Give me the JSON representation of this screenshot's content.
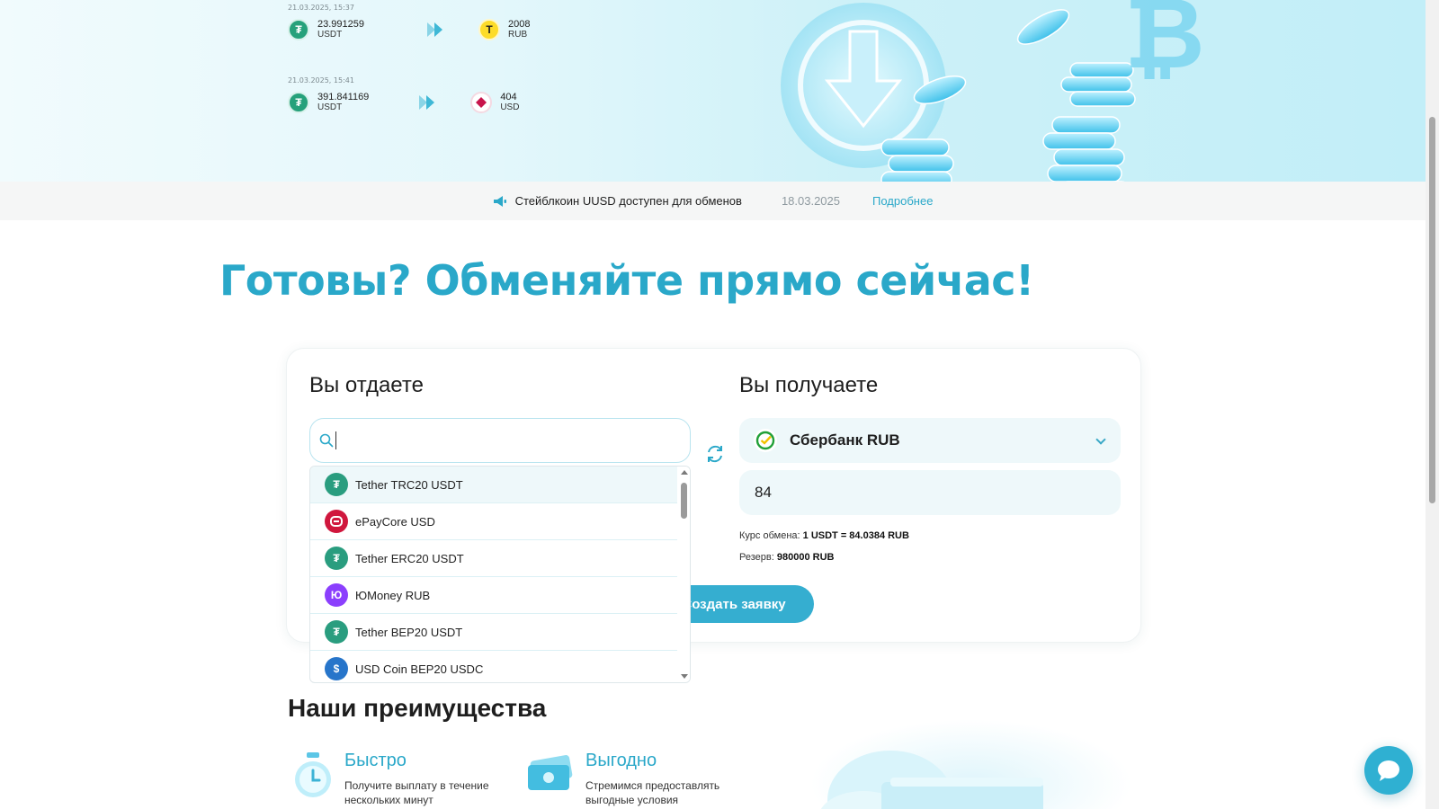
{
  "hero": {
    "transactions": [
      {
        "date": "21.03.2025, 15:37",
        "from_amount": "23.991259",
        "from_currency": "USDT",
        "to_amount": "2008",
        "to_currency": "RUB"
      },
      {
        "date": "21.03.2025, 15:41",
        "from_amount": "391.841169",
        "from_currency": "USDT",
        "to_amount": "404",
        "to_currency": "USD"
      }
    ]
  },
  "news": {
    "text": "Стейблкоин UUSD доступен для обменов",
    "date": "18.03.2025",
    "link": "Подробнее"
  },
  "headline": "Готовы? Обменяйте прямо сейчас!",
  "exchange": {
    "give_title": "Вы отдаете",
    "get_title": "Вы получаете",
    "search_value": "",
    "currency_list": [
      {
        "label": "Tether TRC20 USDT",
        "icon": "tether-icon"
      },
      {
        "label": "ePayCore USD",
        "icon": "epaycore-icon"
      },
      {
        "label": "Tether ERC20 USDT",
        "icon": "tether-icon"
      },
      {
        "label": "ЮMoney RUB",
        "icon": "yoomoney-icon"
      },
      {
        "label": "Tether BEP20 USDT",
        "icon": "tether-icon"
      },
      {
        "label": "USD Coin BEP20 USDC",
        "icon": "usdc-icon"
      }
    ],
    "receive_method": "Сбербанк RUB",
    "receive_amount": "84",
    "rate_label": "Курс обмена:",
    "rate_value": "1 USDT = 84.0384 RUB",
    "reserve_label": "Резерв:",
    "reserve_value": "980000 RUB",
    "submit_label": "Создать заявку"
  },
  "advantages": {
    "title": "Наши преимущества",
    "items": [
      {
        "name": "Быстро",
        "desc": "Получите выплату в течение нескольких минут",
        "icon": "stopwatch-icon"
      },
      {
        "name": "Выгодно",
        "desc": "Стремимся предоставлять выгодные условия",
        "icon": "banknotes-icon"
      }
    ]
  },
  "colors": {
    "accent": "#2aa8c9",
    "button": "#35aed0",
    "field_bg": "#eef8fa"
  }
}
